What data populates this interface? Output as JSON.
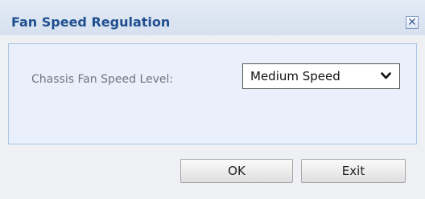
{
  "dialog": {
    "title": "Fan Speed Regulation",
    "close_icon": "close-icon",
    "close_glyph": "✕"
  },
  "form": {
    "fan_speed_label": "Chassis Fan Speed Level:",
    "fan_speed_selected": "Medium Speed",
    "chevron_icon": "chevron-down-icon"
  },
  "buttons": {
    "ok_label": "OK",
    "exit_label": "Exit"
  },
  "colors": {
    "title_text": "#1f4f8f",
    "panel_background": "#eaf0fb",
    "panel_border": "#a9c4e3",
    "dialog_background": "#eef0f4"
  }
}
